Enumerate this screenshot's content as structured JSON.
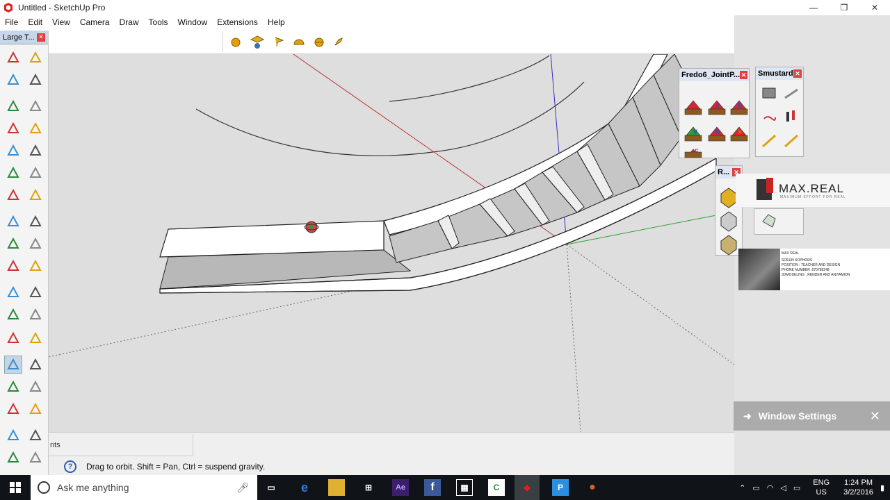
{
  "window": {
    "title": "Untitled - SketchUp Pro",
    "controls": [
      "—",
      "❐",
      "✕"
    ]
  },
  "menu": [
    "File",
    "Edit",
    "View",
    "Camera",
    "Draw",
    "Tools",
    "Window",
    "Extensions",
    "Help"
  ],
  "palette": {
    "title": "Large T...",
    "close": "✕",
    "tools": [
      "select-icon",
      "component-icon",
      "paint-bucket-icon",
      "eraser-icon",
      "line-icon",
      "freehand-icon",
      "rectangle-icon",
      "rotated-rectangle-icon",
      "circle-icon",
      "polygon-icon",
      "arc-icon",
      "arc-2pt-icon",
      "arc-3pt-icon",
      "pie-icon",
      "move-icon",
      "push-pull-icon",
      "rotate-icon",
      "follow-me-icon",
      "scale-icon",
      "offset-icon",
      "tape-measure-icon",
      "dimension-icon",
      "protractor-icon",
      "text-icon",
      "axes-icon",
      "3d-text-icon",
      "orbit-icon",
      "pan-icon",
      "zoom-icon",
      "zoom-window-icon",
      "zoom-extents-icon",
      "previous-icon",
      "position-camera-icon",
      "look-around-icon",
      "walk-icon",
      "section-plane-icon"
    ]
  },
  "panels": {
    "fredo": {
      "title": "Fredo6_JointP...",
      "close": "✕",
      "icon_letters": [
        "",
        "J",
        "R",
        "V",
        "N",
        "X",
        "F"
      ]
    },
    "smustard": {
      "title": "Smustard",
      "close": "✕"
    },
    "r": {
      "title": "R...",
      "close": "✕"
    }
  },
  "logo": {
    "title": "MAX.REAL",
    "subtitle": "MAXIMUM EFFORT FOR REAL",
    "info": [
      "MAX REAL",
      "SOEUN SOPHORS",
      "POSITION : TEACHER AND DESIGN",
      "PHONE NUMBER :070789248",
      "3DMODELING , RENDER AND ANITAMION"
    ]
  },
  "toast": {
    "label": "Window Settings",
    "close": "✕"
  },
  "status": {
    "measurements_label": "nts",
    "help": "?",
    "message": "Drag to orbit. Shift = Pan, Ctrl = suspend gravity."
  },
  "taskbar": {
    "search_placeholder": "Ask me anything",
    "lang": "ENG",
    "region": "US",
    "time": "1:24 PM",
    "date": "3/2/2016",
    "apps": [
      "task-view-icon",
      "edge-icon",
      "file-explorer-icon",
      "store-icon",
      "after-effects-icon",
      "facebook-icon",
      "film-icon",
      "camtasia-icon",
      "sketchup-icon",
      "pinterest-icon",
      "firefox-icon"
    ]
  },
  "colors": {
    "axis_red": "#c03030",
    "axis_green": "#30a030",
    "axis_blue": "#3030c0",
    "sky": "#dedede"
  }
}
